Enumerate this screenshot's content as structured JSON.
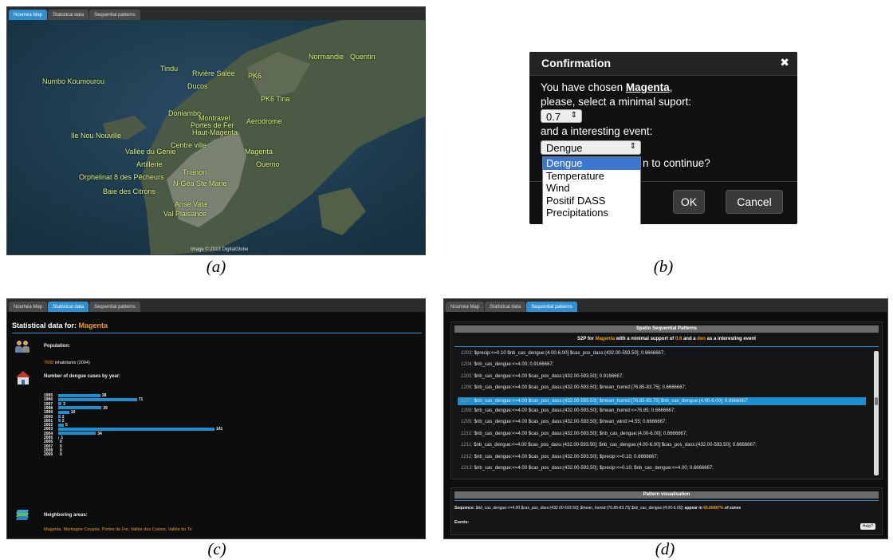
{
  "tabs": {
    "map": "Nouméa Map",
    "stat": "Statistical data",
    "seq": "Sequential patterns"
  },
  "captions": {
    "a": "(a)",
    "b": "(b)",
    "c": "(c)",
    "d": "(d)"
  },
  "map": {
    "credit": "Image © 2013 DigitalGlobe",
    "labels": [
      "Normandie",
      "Quentin",
      "Tindu",
      "Numbo Koumourou",
      "Rivière Salée",
      "Ducos",
      "PK6",
      "PK6 Tina",
      "Doniambo",
      "Montravel",
      "Aerodrome",
      "Portes de Fer",
      "Haut-Magenta",
      "Ile Nou Nouville",
      "Centre ville",
      "Vallée du Génie",
      "Magenta",
      "Artillerie",
      "Ouemo",
      "Orphelinat 8 des Pêcheurs",
      "Trianon",
      "Baie des Citrons",
      "N-Géa Ste Marie",
      "Anse Vata",
      "Val Plaisance"
    ]
  },
  "dialog": {
    "title": "Confirmation",
    "close": "✖",
    "line1_pre": "You have chosen ",
    "line1_name": "Magenta",
    "line1_post": ",",
    "line2": "please, select a minimal suport:",
    "support_value": "0.7",
    "line3": "and a interesting event:",
    "event_value": "Dengue",
    "continue_tail": "n to continue?",
    "options": [
      "Dengue",
      "Temperature",
      "Wind",
      "Positif DASS",
      "Precipitations"
    ],
    "ok": "OK",
    "cancel": "Cancel"
  },
  "stats": {
    "title_pre": "Statistical data for: ",
    "title_name": "Magenta",
    "population_label": "Population:",
    "population_value": "7508",
    "population_unit": " inhabitants (2004)",
    "dengue_label": "Number of dengue cases by year:",
    "neighbors_label": "Neighboring areas:",
    "neighbors": "Magenta, Montagne Coupée, Portes de Fer, Vallée des Colons, Vallée du Tir"
  },
  "chart_data": {
    "type": "bar",
    "orientation": "horizontal",
    "categories": [
      "1995",
      "1996",
      "1997",
      "1998",
      "1999",
      "2000",
      "2001",
      "2002",
      "2003",
      "2004",
      "2005",
      "2006",
      "2007",
      "2008",
      "2009"
    ],
    "values": [
      38,
      71,
      3,
      39,
      10,
      2,
      2,
      5,
      141,
      34,
      1,
      0,
      0,
      0,
      0
    ],
    "bar_color": "#1b8fd0"
  },
  "seq": {
    "header": "Spatio Sequential Patterns",
    "sub_pre": "S2P for ",
    "sub_name": "Magenta",
    "sub_mid": " with a minimal support of ",
    "sub_support": "0.6",
    "sub_and": " and a ",
    "sub_event": "den",
    "sub_post": " as a interesting event",
    "rows": [
      {
        "id": "1203;",
        "text": " $precip:<=0.10 $nb_cas_dengue:(4.00-6.00] $cas_pos_dass:(432.00-593.50]; 0.6666667;"
      },
      {
        "id": "1204;",
        "text": " $nb_cas_dengue:<=4.00; 0.9166667;"
      },
      {
        "id": "1205;",
        "text": " $nb_cas_dengue:<=4.00 $cas_pos_dass:(432.00-593.50]; 0.9166667;"
      },
      {
        "id": "1206;",
        "text": " $nb_cas_dengue:<=4.00 $cas_pos_dass:(432.00-593.50]; $mean_humid:(76.85-83.75]; 0.6666667;"
      },
      {
        "id": "1207;",
        "text": " $nb_cas_dengue:<=4.00 $cas_pos_dass:(432.00-593.50]; $mean_humid:(76.85-83.75] $nb_cas_dengue:(4.00-6.00]; 0.6666667;"
      },
      {
        "id": "1208;",
        "text": " $nb_cas_dengue:<=4.00 $cas_pos_dass:(432.00-593.50]; $mean_humid:<=76.85; 0.6666667;"
      },
      {
        "id": "1209;",
        "text": " $nb_cas_dengue:<=4.00 $cas_pos_dass:(432.00-593.50]; $mean_wind:>4.55; 0.6666667;"
      },
      {
        "id": "1210;",
        "text": " $nb_cas_dengue:<=4.00 $cas_pos_dass:(432.00-593.50]; $nb_cas_dengue:(4.00-6.00]; 0.6666667;"
      },
      {
        "id": "1211;",
        "text": " $nb_cas_dengue:<=4.00 $cas_pos_dass:(432.00-593.50]; $nb_cas_dengue:(4.00-6.00] $cas_pos_dass:(432.00-593.50]; 0.6666667;"
      },
      {
        "id": "1212;",
        "text": " $nb_cas_dengue:<=4.00 $cas_pos_dass:(432.00-593.50]; $precip:<=0.10; 0.6666667;"
      },
      {
        "id": "1213;",
        "text": " $nb_cas_dengue:<=4.00 $cas_pos_dass:(432.00-593.50]; $precip:<=0.10; $nb_cas_dengue:<=4.00; 0.6666667;"
      }
    ],
    "selected_index": 4,
    "vis_header": "Pattern visualisation",
    "seq_label": "Sequence: ",
    "seq_value": "$nb_cas_dengue:<=4.00 $cas_pos_dass:(432.00-593.50]; $mean_humid:(76.85-83.75] $nb_cas_dengue:(4.00-6.00];",
    "appear_pre": " appear in ",
    "appear_pct": "66.66667%",
    "appear_post": " of zones",
    "events_label": "Events:",
    "help": "Help?"
  },
  "colors": {
    "accent": "#2f8fd0",
    "orange": "#f39c12",
    "bar": "#1b8fd0",
    "map_label": "#dcf07a"
  }
}
